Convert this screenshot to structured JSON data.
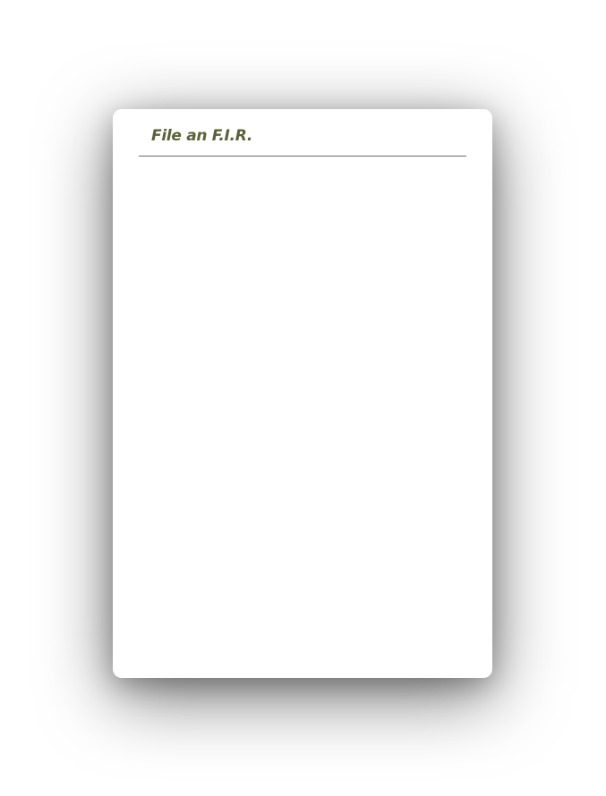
{
  "dialog": {
    "title": "File an F.I.R.",
    "title_color": "#5c6138"
  }
}
